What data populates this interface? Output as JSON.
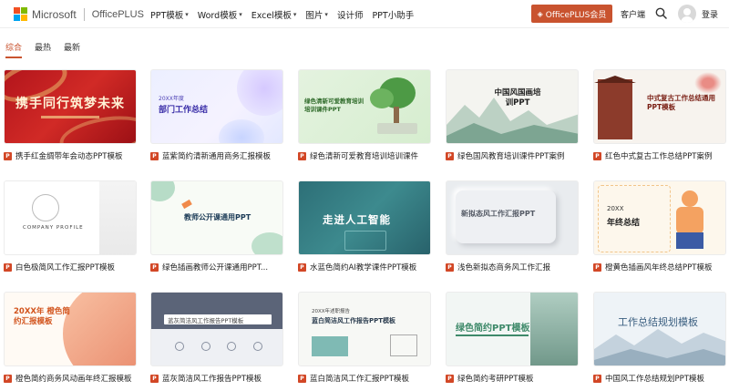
{
  "header": {
    "brand": "Microsoft",
    "product": "OfficePLUS",
    "nav": [
      {
        "label": "PPT模板",
        "has_caret": true
      },
      {
        "label": "Word模板",
        "has_caret": true
      },
      {
        "label": "Excel模板",
        "has_caret": true
      },
      {
        "label": "图片",
        "has_caret": true
      },
      {
        "label": "设计师",
        "has_caret": false
      },
      {
        "label": "PPT小助手",
        "has_caret": false
      }
    ],
    "member_button": "OfficePLUS会员",
    "client_link": "客户端",
    "login_link": "登录",
    "colors": {
      "accent": "#c9532f",
      "ms_red": "#f25022",
      "ms_green": "#7fba00",
      "ms_blue": "#00a4ef",
      "ms_yellow": "#ffb900"
    }
  },
  "tabs": [
    {
      "label": "综合",
      "active": true
    },
    {
      "label": "最热",
      "active": false
    },
    {
      "label": "最新",
      "active": false
    }
  ],
  "cards": [
    {
      "caption": "携手红金绸带年会动态PPT模板",
      "thumb_title": "携手同行筑梦未来",
      "thumb_sub": ""
    },
    {
      "caption": "蓝紫简约清新通用商务汇报模板",
      "thumb_title": "部门工作总结",
      "thumb_sub": "20XX年度"
    },
    {
      "caption": "绿色清新可爱教育培训培训课件",
      "thumb_title": "绿色清新可爱教育培训 培训课件PPT",
      "thumb_sub": ""
    },
    {
      "caption": "绿色国风教育培训课件PPT案例",
      "thumb_title": "中国风国画培训PPT",
      "thumb_sub": ""
    },
    {
      "caption": "红色中式复古工作总结PPT案例",
      "thumb_title": "中式复古工作总结通用PPT模板",
      "thumb_sub": ""
    },
    {
      "caption": "白色极简风工作汇报PPT模板",
      "thumb_title": "COMPANY PROFILE",
      "thumb_sub": ""
    },
    {
      "caption": "绿色插画教师公开课通用PPT...",
      "thumb_title": "教师公开课通用PPT",
      "thumb_sub": ""
    },
    {
      "caption": "水蓝色简约AI教学课件PPT模板",
      "thumb_title": "走进人工智能",
      "thumb_sub": ""
    },
    {
      "caption": "浅色新拟态商务风工作汇报",
      "thumb_title": "新拟态风工作汇报PPT",
      "thumb_sub": ""
    },
    {
      "caption": "橙黄色插画风年终总结PPT模板",
      "thumb_title": "年终总结",
      "thumb_sub": "20XX"
    },
    {
      "caption": "橙色简约商务风动画年终汇报模板",
      "thumb_title": "20XX年 橙色简约汇报模板",
      "thumb_sub": ""
    },
    {
      "caption": "蓝灰简洁风工作报告PPT模板",
      "thumb_title": "蓝灰简洁风工作报告PPT模板",
      "thumb_sub": ""
    },
    {
      "caption": "蓝白简洁风工作汇报PPT模板",
      "thumb_title": "蓝白简洁风工作报告PPT模板",
      "thumb_sub": "20XX年述职报告"
    },
    {
      "caption": "绿色简约考研PPT模板",
      "thumb_title": "绿色简约PPT模板",
      "thumb_sub": ""
    },
    {
      "caption": "中国风工作总结规划PPT模板",
      "thumb_title": "工作总结规划模板",
      "thumb_sub": ""
    }
  ]
}
